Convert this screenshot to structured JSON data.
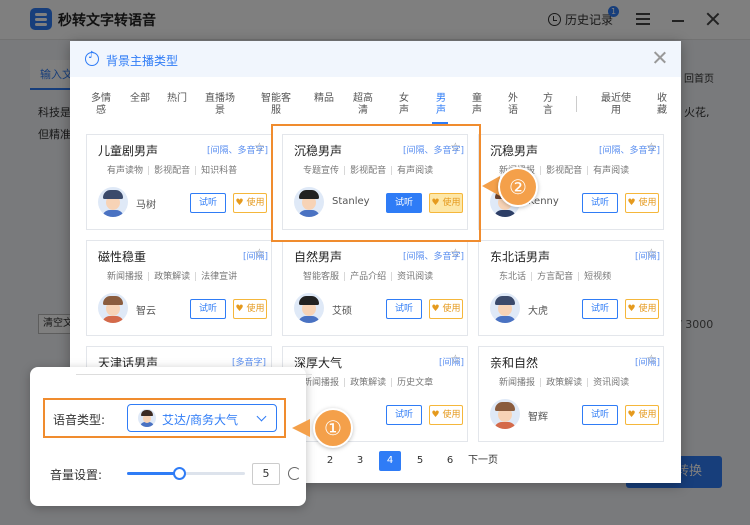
{
  "app": {
    "title": "秒转文字转语音",
    "history_label": "历史记录",
    "history_badge": "1",
    "tab_label": "输入文",
    "body_line1": "科技是",
    "body_line2": "但精准",
    "right_link": "回首页",
    "right_text": "火花,",
    "clear_label": "清空文",
    "char_count": "/ 3000",
    "convert_label": "转换"
  },
  "modal": {
    "title": "背景主播类型",
    "categories": [
      "多情感",
      "全部",
      "热门",
      "直播场景",
      "智能客服",
      "精品",
      "超高清",
      "女声",
      "男声",
      "童声",
      "外语",
      "方言",
      "最近使用",
      "收藏"
    ],
    "active_category": "男声",
    "use_label": "使用",
    "listen_label": "试听",
    "cards": [
      {
        "name": "儿童剧男声",
        "badge": "[间隔、多音字]",
        "tags": [
          "有声读物",
          "影视配音",
          "知识科普"
        ],
        "speaker": "马树"
      },
      {
        "name": "沉稳男声",
        "badge": "[间隔、多音字]",
        "tags": [
          "专题宣传",
          "影视配音",
          "有声阅读"
        ],
        "speaker": "Stanley"
      },
      {
        "name": "沉稳男声",
        "badge": "[间隔、多音字]",
        "tags": [
          "新闻播报",
          "影视配音",
          "有声阅读"
        ],
        "speaker": "Kenny"
      },
      {
        "name": "磁性稳重",
        "badge": "[间隔]",
        "tags": [
          "新闻播报",
          "政策解读",
          "法律宣讲"
        ],
        "speaker": "智云"
      },
      {
        "name": "自然男声",
        "badge": "[间隔、多音字]",
        "tags": [
          "智能客服",
          "产品介绍",
          "资讯阅读"
        ],
        "speaker": "艾硕"
      },
      {
        "name": "东北话男声",
        "badge": "[间隔]",
        "tags": [
          "东北话",
          "方言配音",
          "短视频"
        ],
        "speaker": "大虎"
      },
      {
        "name": "天津话男声",
        "badge": "[多音字]",
        "tags": [],
        "speaker": ""
      },
      {
        "name": "深厚大气",
        "badge": "[间隔]",
        "tags": [
          "新闻播报",
          "政策解读",
          "历史文章"
        ],
        "speaker": ""
      },
      {
        "name": "亲和自然",
        "badge": "[间隔]",
        "tags": [
          "新闻播报",
          "政策解读",
          "资讯阅读"
        ],
        "speaker": "智辉"
      }
    ],
    "pagination": {
      "pages": [
        "2",
        "3",
        "4",
        "5",
        "6"
      ],
      "current": "4",
      "next_label": "下一页"
    }
  },
  "panel": {
    "voice_label": "语音类型:",
    "voice_value": "艾达/商务大气",
    "volume_label": "音量设置:",
    "volume_value": "5",
    "volume_fraction": 0.44
  },
  "steps": {
    "one": "①",
    "two": "②"
  },
  "colors": {
    "accent": "#2f7cf6",
    "highlight": "#f08c2e",
    "step_fill": "#f4a04a",
    "use_gold": "#e59a1e"
  }
}
